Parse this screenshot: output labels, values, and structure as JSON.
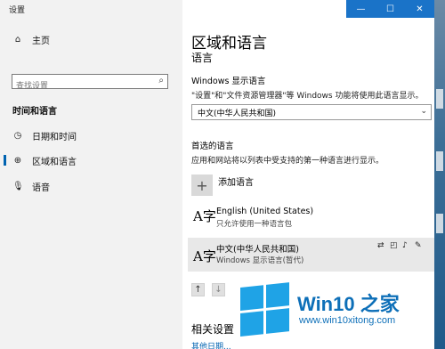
{
  "window": {
    "title": "设置",
    "min_glyph": "—",
    "max_glyph": "☐",
    "close_glyph": "✕"
  },
  "nav": {
    "home": {
      "label": "主页",
      "icon": "home-icon"
    },
    "search": {
      "placeholder": "查找设置",
      "icon": "search-icon"
    },
    "section": "时间和语言",
    "items": [
      {
        "label": "日期和时间",
        "icon": "calendar-clock-icon",
        "active": false
      },
      {
        "label": "区域和语言",
        "icon": "globe-icon",
        "active": true
      },
      {
        "label": "语音",
        "icon": "microphone-icon",
        "active": false
      }
    ]
  },
  "content": {
    "title": "区域和语言",
    "subtitle": "语言",
    "display_lang_label": "Windows 显示语言",
    "display_lang_hint": "\"设置\"和\"文件资源管理器\"等 Windows 功能将使用此语言显示。",
    "display_lang_value": "中文(中华人民共和国)",
    "pref_label": "首选的语言",
    "pref_hint": "应用和网站将以列表中受支持的第一种语言进行显示。",
    "add_label": "添加语言",
    "languages": [
      {
        "name": "English (United States)",
        "sub": "只允许使用一种语言包",
        "glyph": "A字"
      },
      {
        "name": "中文(中华人民共和国)",
        "sub": "Windows 显示语言(暂代)",
        "glyph": "A字"
      }
    ],
    "related": "相关设置",
    "related_link": "其他日期..."
  },
  "watermark": {
    "title": "Win10 之家",
    "url": "www.win10xitong.com"
  },
  "colors": {
    "accent": "#0063b1",
    "titlebar": "#1a73c8",
    "watermark": "#0d6fb8"
  }
}
